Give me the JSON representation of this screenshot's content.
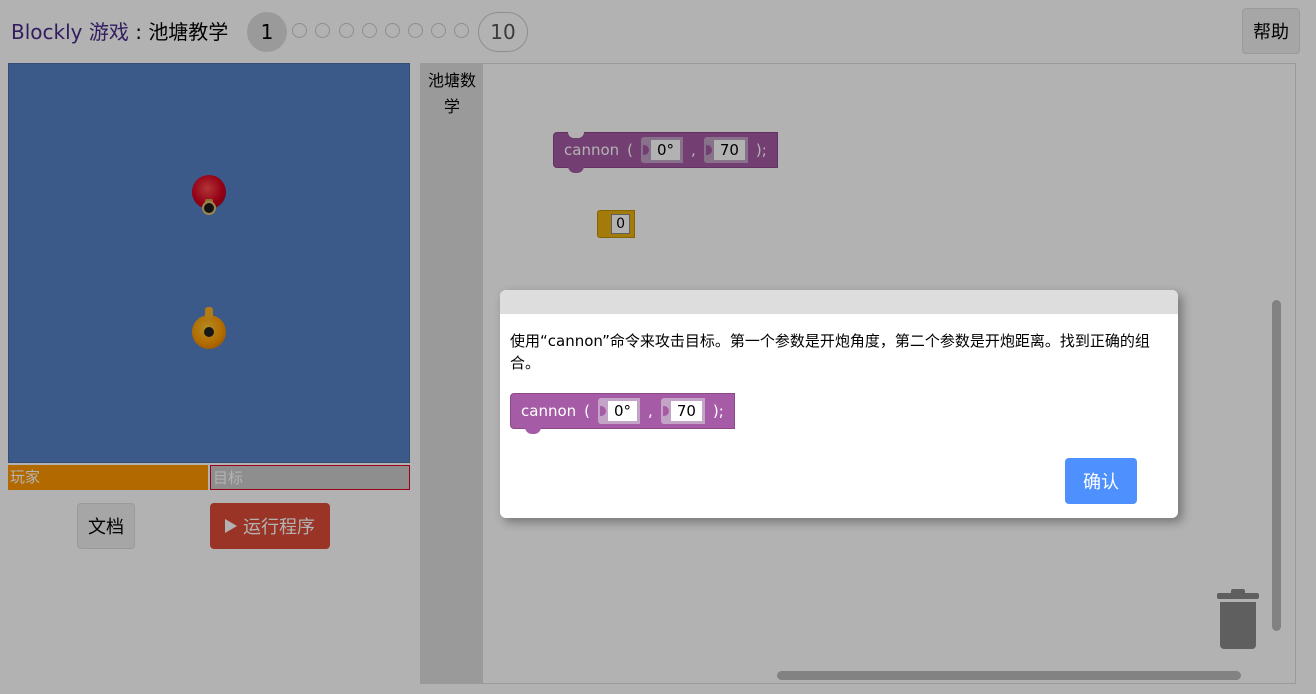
{
  "header": {
    "brand": "Blockly",
    "game": "游戏",
    "separator": ":",
    "level_name": "池塘教学",
    "levels": {
      "current": "1",
      "last": "10"
    },
    "help_label": "帮助"
  },
  "arena": {
    "health_player": "玩家",
    "health_target": "目标"
  },
  "controls": {
    "doc_label": "文档",
    "run_label": "运行程序",
    "run_icon": "play-icon"
  },
  "workspace": {
    "toolbox_category": "池塘数学",
    "cannon_block": {
      "keyword": "cannon",
      "open": "(",
      "angle": "0°",
      "comma": ",",
      "distance": "70",
      "close": ");"
    },
    "number_block": {
      "value": "0"
    }
  },
  "dialog": {
    "text": "使用“cannon”命令来攻击目标。第一个参数是开炮角度，第二个参数是开炮距离。找到正确的组合。",
    "example_block": {
      "keyword": "cannon",
      "open": "(",
      "angle": "0°",
      "comma": ",",
      "distance": "70",
      "close": ");"
    },
    "confirm_label": "确认"
  },
  "colors": {
    "arena_bg": "#5581c5",
    "player_health": "#ff9800",
    "run_button": "#dd4b39",
    "confirm_button": "#4d90fe",
    "procedure_block": "#a55ba5",
    "math_block": "#e8b010"
  }
}
